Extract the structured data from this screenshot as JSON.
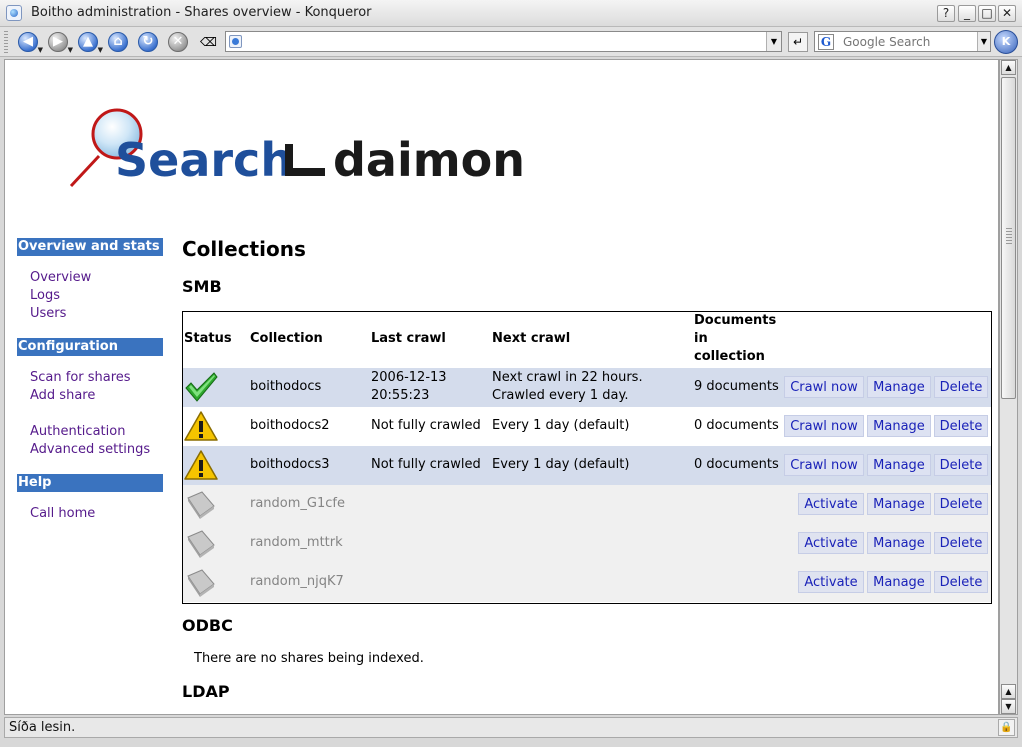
{
  "window": {
    "title": "Boitho administration - Shares overview - Konqueror",
    "controls": [
      "?",
      "_",
      "□",
      "✕"
    ]
  },
  "toolbar": {
    "buttons": [
      "back",
      "forward",
      "up",
      "home",
      "reload",
      "stop"
    ],
    "url_value": "",
    "search_placeholder": "Google Search",
    "search_engine_glyph": "G"
  },
  "logo": {
    "text_blue": "Search",
    "text_black": "daimon"
  },
  "sidebar": {
    "sections": [
      {
        "title": "Overview and stats",
        "links": [
          "Overview",
          "Logs",
          "Users"
        ]
      },
      {
        "title": "Configuration",
        "links": [
          "Scan for shares",
          "Add share",
          "Authentication",
          "Advanced settings"
        ]
      },
      {
        "title": "Help",
        "links": [
          "Call home"
        ]
      }
    ]
  },
  "main": {
    "title": "Collections",
    "smb": {
      "heading": "SMB",
      "columns": {
        "status": "Status",
        "collection": "Collection",
        "last_crawl": "Last crawl",
        "next_crawl": "Next crawl",
        "documents_1": "Documents",
        "documents_2": "in",
        "documents_3": "collection"
      },
      "rows": [
        {
          "status": "ok",
          "collection": "boithodocs",
          "last_crawl_1": "2006-12-13",
          "last_crawl_2": "20:55:23",
          "next_crawl_1": "Next crawl in 22 hours.",
          "next_crawl_2": "Crawled every 1 day.",
          "documents": "9 documents",
          "actions": [
            "Crawl now",
            "Manage",
            "Delete"
          ]
        },
        {
          "status": "warning",
          "collection": "boithodocs2",
          "last_crawl_1": "Not fully crawled",
          "last_crawl_2": "",
          "next_crawl_1": "Every 1 day (default)",
          "next_crawl_2": "",
          "documents": "0 documents",
          "actions": [
            "Crawl now",
            "Manage",
            "Delete"
          ]
        },
        {
          "status": "warning",
          "collection": "boithodocs3",
          "last_crawl_1": "Not fully crawled",
          "last_crawl_2": "",
          "next_crawl_1": "Every 1 day (default)",
          "next_crawl_2": "",
          "documents": "0 documents",
          "actions": [
            "Crawl now",
            "Manage",
            "Delete"
          ]
        },
        {
          "status": "inactive",
          "collection": "random_G1cfe",
          "last_crawl_1": "",
          "last_crawl_2": "",
          "next_crawl_1": "",
          "next_crawl_2": "",
          "documents": "",
          "actions": [
            "Activate",
            "Manage",
            "Delete"
          ]
        },
        {
          "status": "inactive",
          "collection": "random_mttrk",
          "last_crawl_1": "",
          "last_crawl_2": "",
          "next_crawl_1": "",
          "next_crawl_2": "",
          "documents": "",
          "actions": [
            "Activate",
            "Manage",
            "Delete"
          ]
        },
        {
          "status": "inactive",
          "collection": "random_njqK7",
          "last_crawl_1": "",
          "last_crawl_2": "",
          "next_crawl_1": "",
          "next_crawl_2": "",
          "documents": "",
          "actions": [
            "Activate",
            "Manage",
            "Delete"
          ]
        }
      ]
    },
    "odbc": {
      "heading": "ODBC",
      "empty_text": "There are no shares being indexed."
    },
    "ldap": {
      "heading": "LDAP"
    }
  },
  "statusbar": {
    "text": "Síða lesin."
  },
  "colors": {
    "menu_header": "#3a73bf",
    "active_row": "#d4dcec",
    "inactive_row": "#f0f0f0",
    "action_link": "#1a22b8",
    "visited_link": "#551a8b"
  }
}
